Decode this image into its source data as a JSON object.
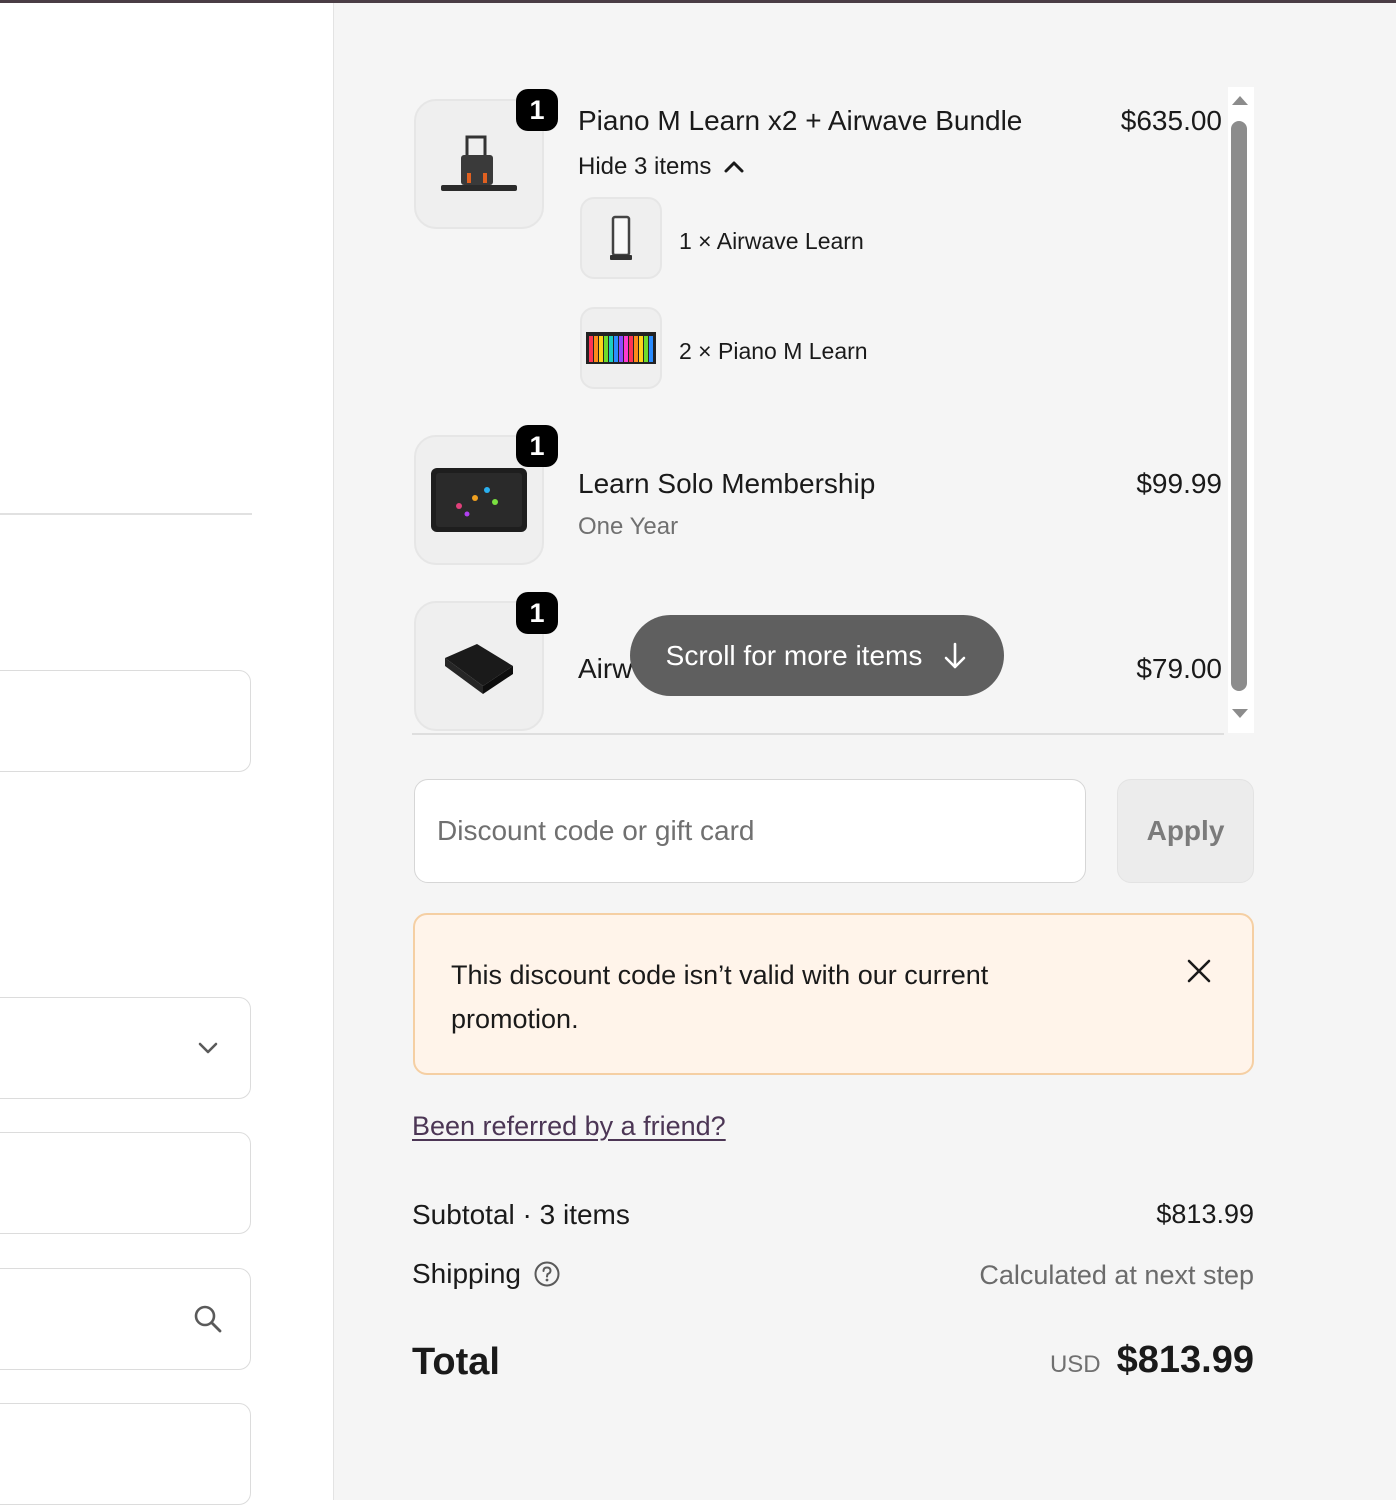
{
  "order_summary": {
    "items": [
      {
        "name": "Piano M Learn x2 + Airwave Bundle",
        "price": "$635.00",
        "quantity": "1",
        "toggle_label": "Hide 3 items",
        "sub_items": [
          {
            "text": "1 × Airwave Learn"
          },
          {
            "text": "2 × Piano M Learn"
          }
        ]
      },
      {
        "name": "Learn Solo Membership",
        "subtitle": "One Year",
        "price": "$99.99",
        "quantity": "1"
      },
      {
        "name": "Airw",
        "price": "$79.00",
        "quantity": "1"
      }
    ],
    "scroll_hint": "Scroll for more items",
    "discount": {
      "placeholder": "Discount code or gift card",
      "apply_label": "Apply"
    },
    "alert": {
      "message": "This discount code isn’t valid with our current promotion."
    },
    "referral_link": "Been referred by a friend?",
    "subtotal": {
      "label": "Subtotal · 3 items",
      "value": "$813.99"
    },
    "shipping": {
      "label": "Shipping",
      "value": "Calculated at next step"
    },
    "total": {
      "label": "Total",
      "currency": "USD",
      "value": "$813.99"
    }
  },
  "colors": {
    "summary_bg": "#f5f5f5",
    "alert_bg": "#fff4ea",
    "alert_border": "#f5cfa3",
    "link": "#4c3655",
    "pill_bg": "#5f5f5f"
  }
}
